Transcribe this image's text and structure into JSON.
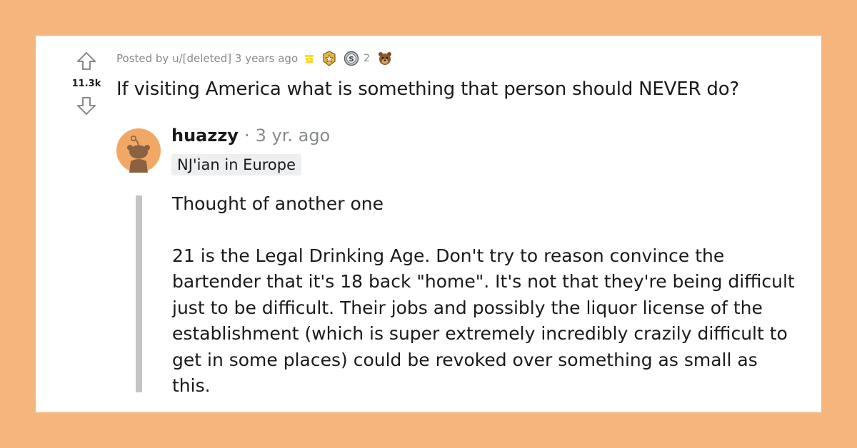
{
  "post": {
    "meta_text": "Posted by u/[deleted] 3 years ago",
    "vote_count": "11.3k",
    "title": "If visiting America what is something that person should NEVER do?",
    "awards": [
      {
        "icon": "archive-badge-icon"
      },
      {
        "icon": "star-medal-award-icon"
      },
      {
        "icon": "silver-award-icon",
        "count": "2"
      },
      {
        "icon": "bear-award-icon"
      }
    ]
  },
  "comment": {
    "username": "huazzy",
    "separator": "·",
    "timestamp": "3 yr. ago",
    "flair": "NJ'ian in Europe",
    "avatar_icon": "reddit-snoo-avatar-icon",
    "paragraphs": [
      "Thought of another one",
      "21 is the Legal Drinking Age. Don't try to reason convince the bartender that it's 18 back \"home\". It's not that they're being difficult just to be difficult. Their jobs and possibly the liquor license of the establishment (which is super extremely incredibly crazily difficult to get in some places) could be revoked over something as small as this."
    ]
  },
  "colors": {
    "background": "#f5b57c",
    "card": "#ffffff",
    "text": "#1a1a1b",
    "meta": "#878a8c",
    "flair_bg": "#edeff1",
    "thread_line": "#c4c4c4",
    "avatar_bg": "#f2a865"
  }
}
